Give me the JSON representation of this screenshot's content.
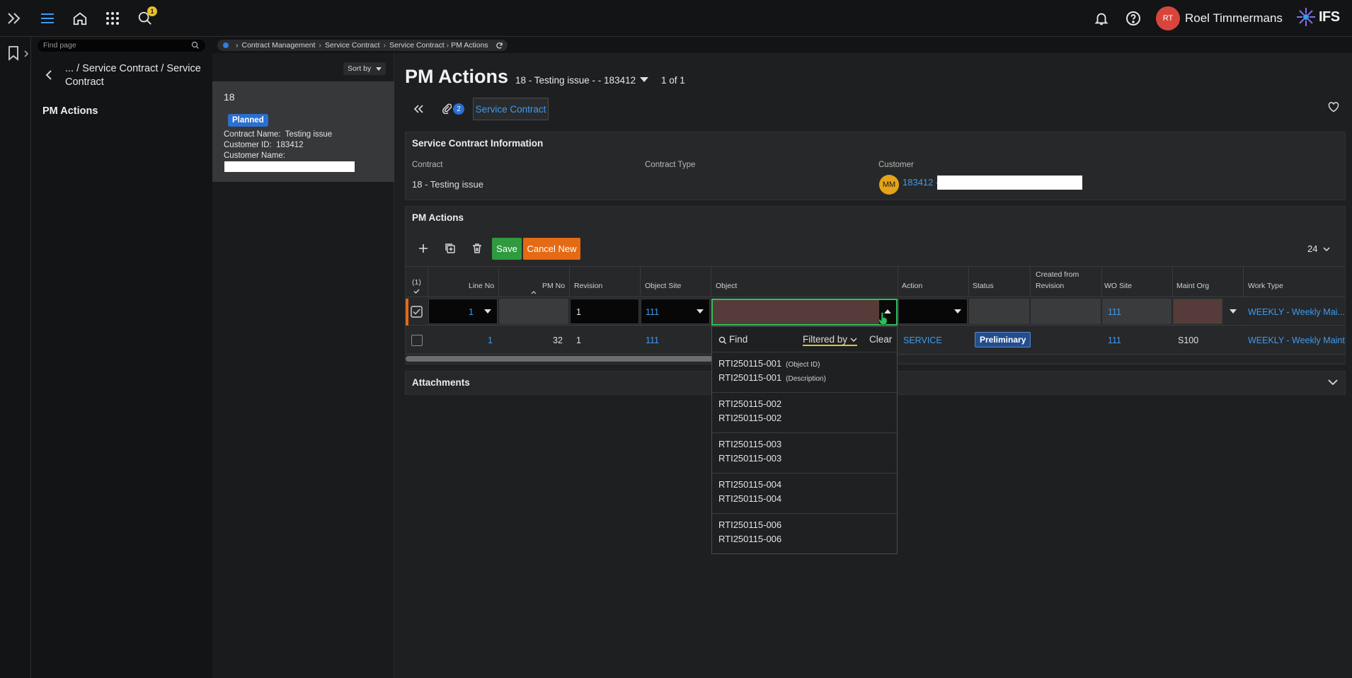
{
  "topbar": {
    "notifications_badge": "1",
    "user_initials": "RT",
    "user_name": "Roel Timmermans",
    "logo_text": "IFS"
  },
  "nav": {
    "find_placeholder": "Find page",
    "path": "... / Service Contract / Service Contract",
    "selected_item": "PM Actions"
  },
  "breadcrumb": [
    "Contract Management",
    "Service Contract",
    "Service Contract",
    "PM Actions"
  ],
  "list": {
    "sort_label": "Sort by",
    "card": {
      "id": "18",
      "status": "Planned",
      "contract_name_label": "Contract Name:",
      "contract_name": "Testing issue",
      "customer_id_label": "Customer ID:",
      "customer_id": "183412",
      "customer_name_label": "Customer Name:"
    }
  },
  "header": {
    "title": "PM Actions",
    "record": "18 - Testing issue - - 183412",
    "record_count": "1 of 1",
    "attachments_count": "2",
    "service_contract_button": "Service Contract"
  },
  "info": {
    "title": "Service Contract Information",
    "contract_label": "Contract",
    "contract_value": "18 - Testing issue",
    "contract_type_label": "Contract Type",
    "customer_label": "Customer",
    "customer_initials": "MM",
    "customer_value": "183412 -"
  },
  "pm_actions": {
    "title": "PM Actions",
    "save_label": "Save",
    "cancel_label": "Cancel New",
    "page_size": "24",
    "selected_count": "(1)",
    "columns": [
      "Line No",
      "PM No",
      "Revision",
      "Object Site",
      "Object",
      "Action",
      "Status",
      "Created from Revision",
      "WO Site",
      "Maint Org",
      "Work Type"
    ],
    "columns_wrapped": {
      "created_from_1": "Created from",
      "created_from_2": "Revision"
    },
    "edit_row": {
      "line_no": "1",
      "revision": "1",
      "object_site": "111",
      "wo_site": "111",
      "work_type": "WEEKLY - Weekly Mai..."
    },
    "row2": {
      "line_no": "1",
      "pm_no": "32",
      "revision": "1",
      "object_site": "111",
      "action": "SERVICE",
      "status": "Preliminary",
      "wo_site": "111",
      "maint_org": "S100",
      "work_type": "WEEKLY - Weekly Mainte"
    }
  },
  "dropdown": {
    "find_label": "Find",
    "filter_label": "Filtered by",
    "clear_label": "Clear",
    "object_id_hint": "(Object ID)",
    "description_hint": "(Description)",
    "items": [
      {
        "id": "RTI250115-001",
        "desc": "RTI250115-001"
      },
      {
        "id": "RTI250115-002",
        "desc": "RTI250115-002"
      },
      {
        "id": "RTI250115-003",
        "desc": "RTI250115-003"
      },
      {
        "id": "RTI250115-004",
        "desc": "RTI250115-004"
      },
      {
        "id": "RTI250115-006",
        "desc": "RTI250115-006"
      }
    ]
  },
  "attachments": {
    "title": "Attachments"
  },
  "colors": {
    "accent": "#3c9bf0",
    "save": "#2f9a3e",
    "cancel": "#e56a14",
    "status_planned": "#2b6fd1"
  }
}
